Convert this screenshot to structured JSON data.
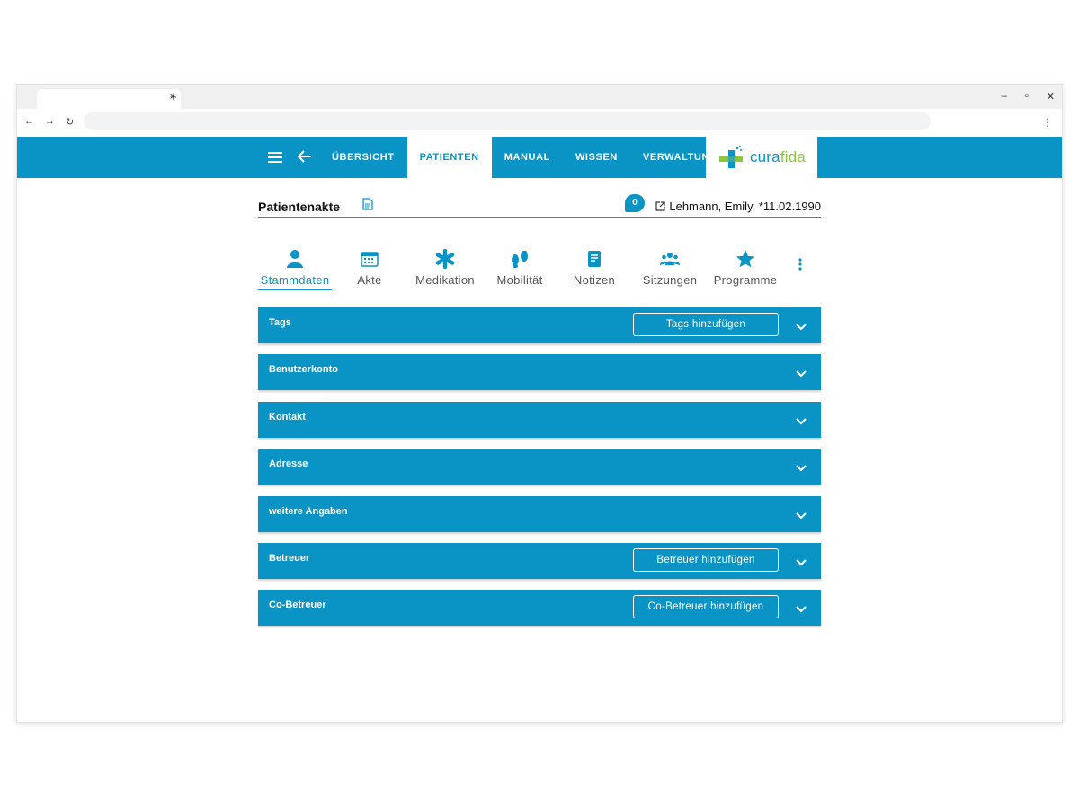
{
  "browser": {
    "tab_close": "×",
    "new_tab": "+",
    "window_controls": [
      "–",
      "▫",
      "✕"
    ],
    "nav": [
      "←",
      "→",
      "↻"
    ],
    "menu": "⋮"
  },
  "appbar": {
    "nav_items": [
      {
        "label": "ÜBERSICHT",
        "active": false
      },
      {
        "label": "PATIENTEN",
        "active": true
      },
      {
        "label": "MANUAL",
        "active": false
      },
      {
        "label": "WISSEN",
        "active": false
      },
      {
        "label": "VERWALTUNG",
        "active": false
      }
    ],
    "logo": {
      "part1": "cura",
      "part2": "fida"
    },
    "colors": {
      "primary": "#0a94c6",
      "logo_green": "#8cc63f"
    }
  },
  "header": {
    "title": "Patientenakte",
    "message_count": "0",
    "patient": "Lehmann, Emily, *11.02.1990"
  },
  "subtabs": [
    {
      "label": "Stammdaten",
      "icon": "person-icon",
      "active": true
    },
    {
      "label": "Akte",
      "icon": "calendar-icon",
      "active": false
    },
    {
      "label": "Medikation",
      "icon": "asterisk-icon",
      "active": false
    },
    {
      "label": "Mobilität",
      "icon": "footprints-icon",
      "active": false
    },
    {
      "label": "Notizen",
      "icon": "note-icon",
      "active": false
    },
    {
      "label": "Sitzungen",
      "icon": "group-icon",
      "active": false
    },
    {
      "label": "Programme",
      "icon": "star-icon",
      "active": false
    }
  ],
  "panels": [
    {
      "title": "Tags",
      "button": "Tags hinzufügen"
    },
    {
      "title": "Benutzerkonto",
      "button": null
    },
    {
      "title": "Kontakt",
      "button": null
    },
    {
      "title": "Adresse",
      "button": null
    },
    {
      "title": "weitere Angaben",
      "button": null
    },
    {
      "title": "Betreuer",
      "button": "Betreuer hinzufügen"
    },
    {
      "title": "Co-Betreuer",
      "button": "Co-Betreuer hinzufügen"
    }
  ]
}
